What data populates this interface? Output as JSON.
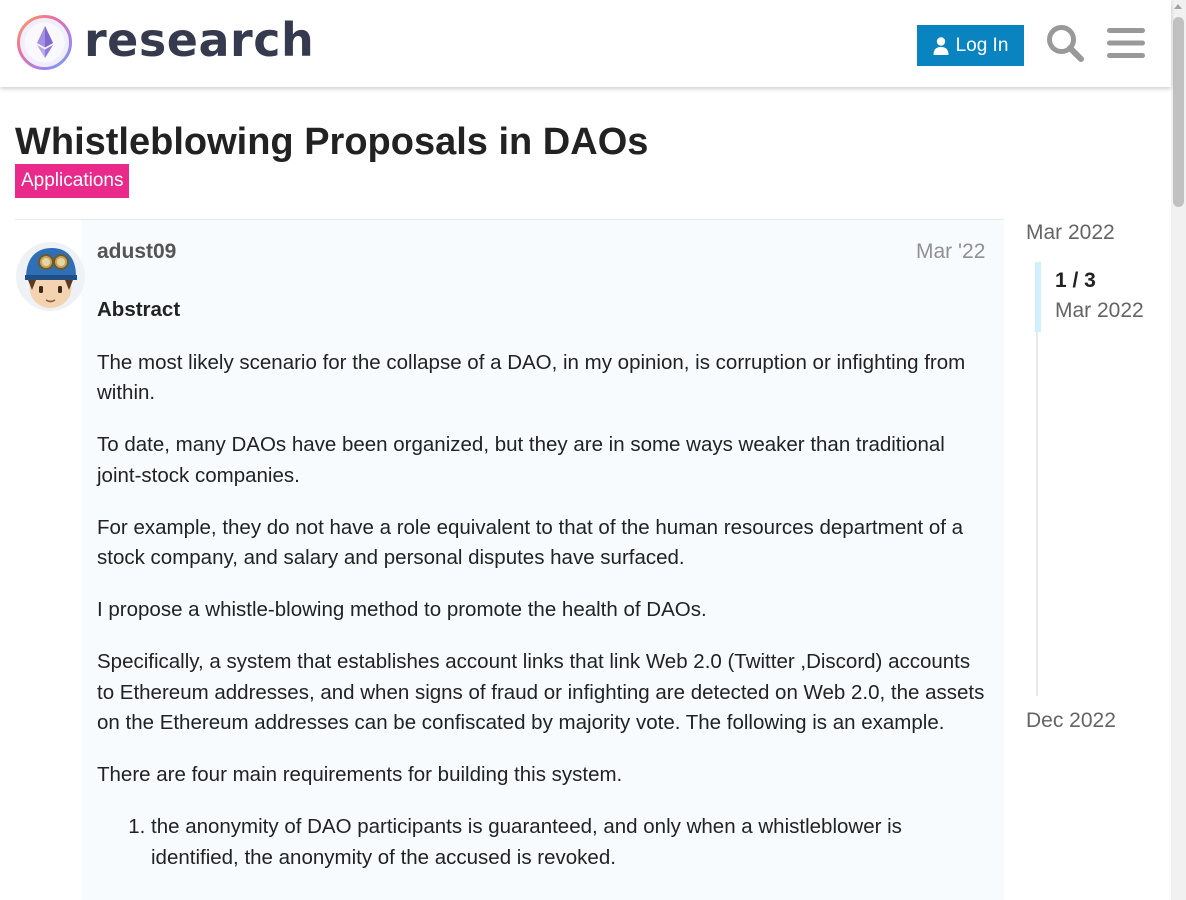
{
  "header": {
    "site_name": "research",
    "login_label": "Log In",
    "colors": {
      "login_button": "#0a84c1",
      "icon_gray": "#999999"
    }
  },
  "topic": {
    "title": "Whistleblowing Proposals in DAOs",
    "category": "Applications",
    "category_color": "#e92a8a"
  },
  "post": {
    "username": "adust09",
    "date": "Mar '22",
    "abstract_heading": "Abstract",
    "paragraphs": [
      "The most likely scenario for the collapse of a DAO, in my opinion, is corruption or infighting from within.",
      "To date, many DAOs have been organized, but they are in some ways weaker than traditional joint-stock companies.",
      "For example, they do not have a role equivalent to that of the human resources department of a stock company, and salary and personal disputes have surfaced.",
      "I propose a whistle-blowing method to promote the health of DAOs.",
      "Specifically, a system that establishes account links that link Web 2.0 (Twitter ,Discord) accounts to Ethereum addresses, and when signs of fraud or infighting are detected on Web 2.0, the assets on the Ethereum addresses can be confiscated by majority vote. The following is an example.",
      "There are four main requirements for building this system."
    ],
    "list_items": [
      "the anonymity of DAO participants is guaranteed, and only when a whistleblower is identified, the anonymity of the accused is revoked."
    ]
  },
  "timeline": {
    "start_date": "Mar 2022",
    "counter": "1 / 3",
    "counter_date": "Mar 2022",
    "end_date": "Dec 2022"
  }
}
